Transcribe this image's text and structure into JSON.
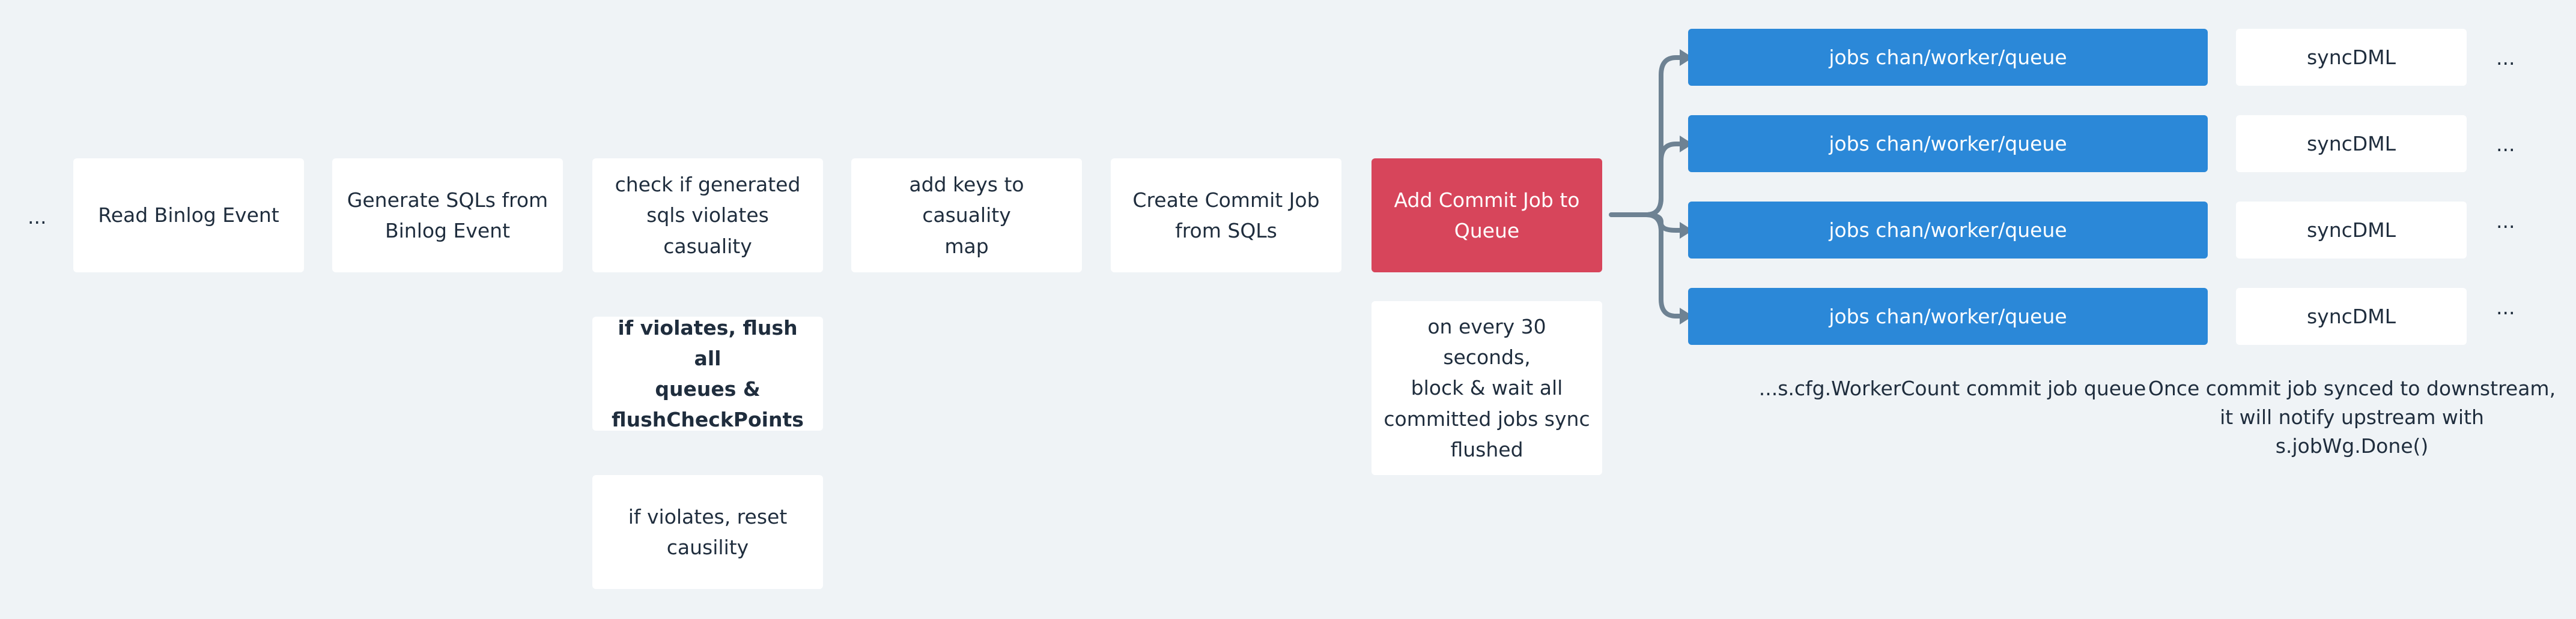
{
  "nodes": {
    "leading_ellipsis": "...",
    "read_binlog": "Read Binlog Event",
    "generate_sqls": "Generate SQLs from\nBinlog Event",
    "check_casuality": "check if generated\nsqls violates\ncasuality",
    "add_keys": "add keys to casuality\nmap",
    "create_commit_job": "Create Commit Job\nfrom SQLs",
    "add_commit_job": "Add Commit Job to\nQueue",
    "flush_on_violation": "if violates, flush all\nqueues &\nflushCheckPoints",
    "reset_causality": "if violates, reset\ncausility",
    "periodic_flush": "on every 30 seconds,\nblock & wait all\ncommitted jobs sync\nflushed"
  },
  "queues": [
    {
      "queue": "jobs chan/worker/queue",
      "sync": "syncDML",
      "more": "..."
    },
    {
      "queue": "jobs chan/worker/queue",
      "sync": "syncDML",
      "more": "..."
    },
    {
      "queue": "jobs chan/worker/queue",
      "sync": "syncDML",
      "more": "..."
    },
    {
      "queue": "jobs chan/worker/queue",
      "sync": "syncDML",
      "more": "..."
    }
  ],
  "captions": {
    "worker_count": "...s.cfg.WorkerCount commit job queue",
    "notify": "Once commit job synced to downstream,\nit will notify upstream with s.jobWg.Done()"
  },
  "colors": {
    "background": "#eff3f6",
    "highlight": "#d7455b",
    "queue": "#2b88d8",
    "connector": "#6e8293"
  }
}
